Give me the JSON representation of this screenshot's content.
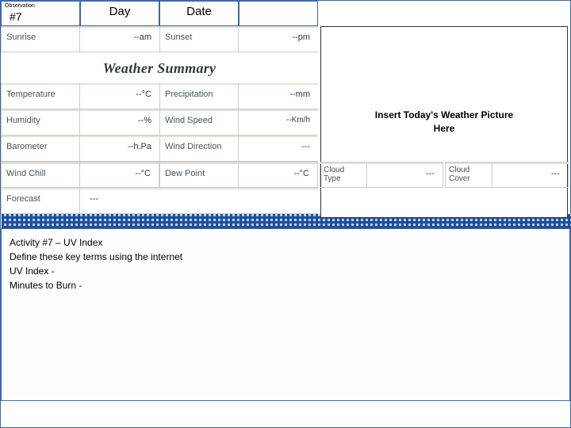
{
  "header": {
    "obs_label": "Observation",
    "obs_num": "#7",
    "day_label": "Day",
    "date_label": "Date"
  },
  "sunrise_label": "Sunrise",
  "sunrise_value": "--am",
  "sunset_label": "Sunset",
  "sunset_value": "--pm",
  "summary_heading": "Weather Summary",
  "picture_placeholder": "Insert Today's Weather Picture Here",
  "rows": {
    "temperature": {
      "label": "Temperature",
      "value": "--°C"
    },
    "precipitation": {
      "label": "Precipitation",
      "value": "--mm"
    },
    "humidity": {
      "label": "Humidity",
      "value": "--%"
    },
    "windspeed": {
      "label": "Wind Speed",
      "value": "--Km/h"
    },
    "barometer": {
      "label": "Barometer",
      "value": "--h.Pa"
    },
    "winddir": {
      "label": "Wind Direction",
      "value": "---"
    },
    "windchill": {
      "label": "Wind Chill",
      "value": "--°C"
    },
    "dewpoint": {
      "label": "Dew Point",
      "value": "--°C"
    },
    "cloudtype": {
      "label": "Cloud Type",
      "value": "---"
    },
    "cloudcover": {
      "label": "Cloud Cover",
      "value": "---"
    },
    "forecast": {
      "label": "Forecast",
      "value": "---"
    }
  },
  "activity": {
    "line1": "Activity #7 – UV Index",
    "line2": "Define these key terms using the internet",
    "line3": "UV Index -",
    "line4": " Minutes to Burn -"
  }
}
